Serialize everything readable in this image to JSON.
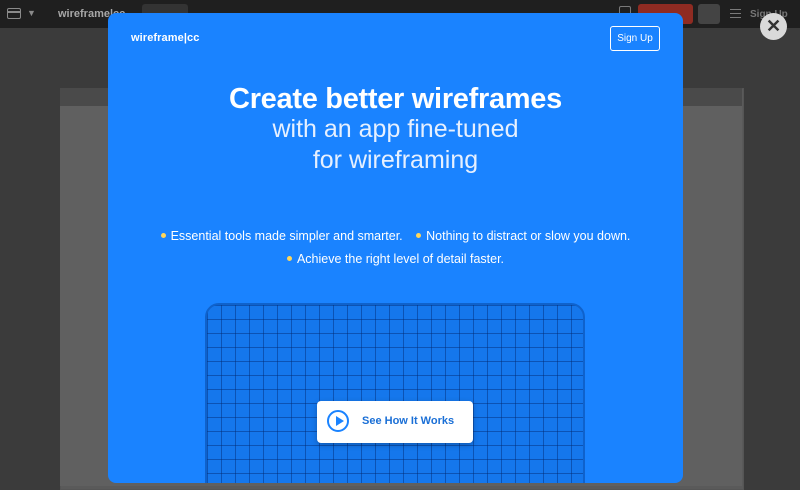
{
  "app": {
    "logo": "wireframe|cc",
    "signup_label": "Sign Up"
  },
  "modal": {
    "logo": "wireframe|cc",
    "signup_label": "Sign Up",
    "headline": "Create better wireframes",
    "subheadline_line1": "with an app fine-tuned",
    "subheadline_line2": "for wireframing",
    "bullets": [
      "Essential tools made simpler and smarter.",
      "Nothing to distract or slow you down.",
      "Achieve the right level of detail faster."
    ],
    "cta_label": "See How It Works",
    "accent_color": "#1a83ff",
    "bullet_color": "#ffd65a"
  },
  "close_icon": "close-icon"
}
